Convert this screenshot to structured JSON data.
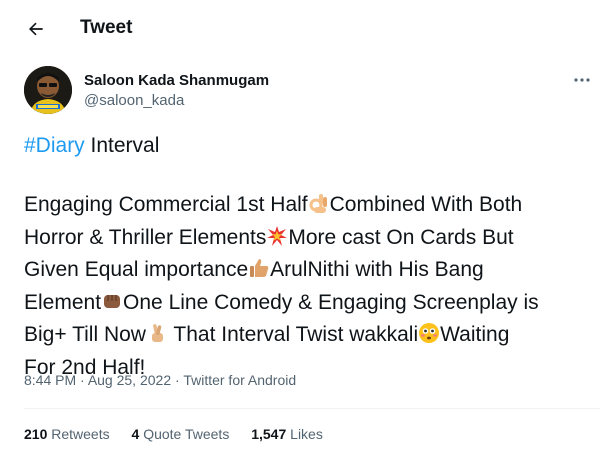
{
  "header": {
    "title": "Tweet",
    "back_icon": "arrow-left-icon"
  },
  "author": {
    "display_name": "Saloon Kada Shanmugam",
    "handle": "@saloon_kada",
    "more_icon": "more-dots-icon"
  },
  "tweet": {
    "lines": [
      {
        "hashtag": "#Diary",
        "text": " Interval"
      },
      {
        "text": ""
      },
      {
        "text": "Engaging Commercial 1st Half",
        "emoji": "ok-hand-icon",
        "tail": "Combined With Both"
      },
      {
        "text": "Horror & Thriller Elements",
        "emoji": "collision-icon",
        "tail": "More cast On Cards But"
      },
      {
        "text": "Given Equal importance",
        "emoji": "thumbs-up-icon",
        "tail": "ArulNithi with His Bang"
      },
      {
        "text": "Element",
        "emoji": "fist-bump-icon",
        "tail": "One Line Comedy & Engaging Screenplay is"
      },
      {
        "text": "Big+ Till Now",
        "emoji": "crossed-fingers-icon",
        "tail": " That Interval Twist wakkali",
        "emoji2": "flushed-face-icon",
        "tail2": "Waiting"
      },
      {
        "text": "For 2nd Half!"
      }
    ]
  },
  "meta": {
    "time": "8:44 PM",
    "separator1": " · ",
    "date": "Aug 25, 2022",
    "separator2": " · ",
    "source": "Twitter for Android"
  },
  "stats": {
    "retweets_count": "210",
    "retweets_label": "Retweets",
    "quotes_count": "4",
    "quotes_label": "Quote Tweets",
    "likes_count": "1,547",
    "likes_label": "Likes"
  },
  "colors": {
    "link": "#1d9bf0",
    "secondary_text": "#536471",
    "primary_text": "#0f1419",
    "divider": "#eff3f4"
  }
}
